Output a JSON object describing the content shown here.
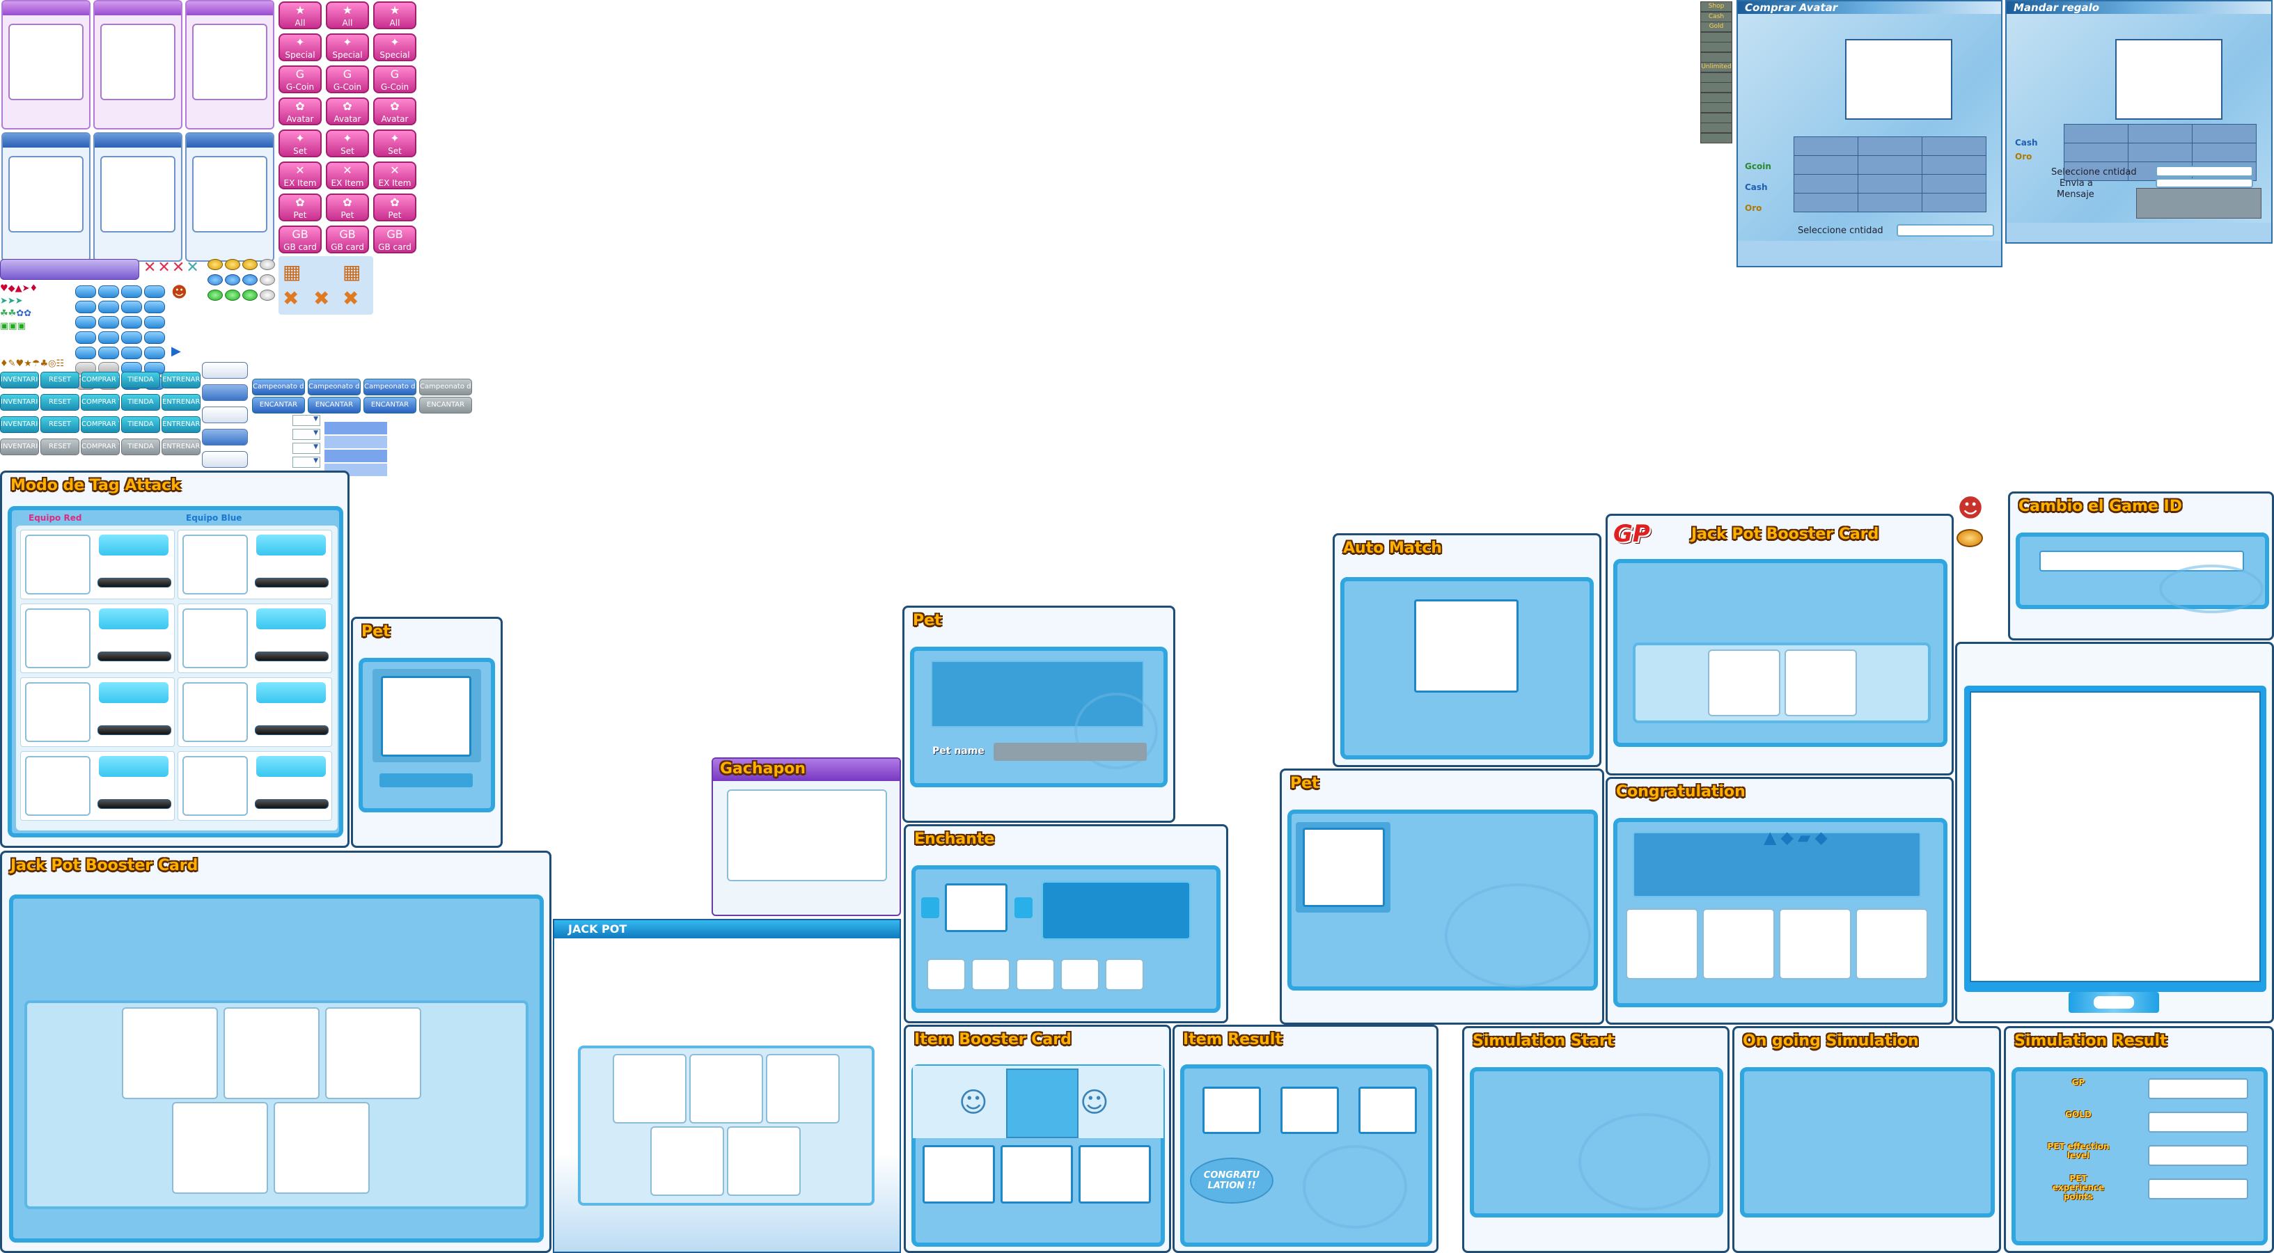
{
  "pink_buttons": [
    {
      "label": "All",
      "icon": "★"
    },
    {
      "label": "Special",
      "icon": "✦"
    },
    {
      "label": "G-Coin",
      "icon": "G"
    },
    {
      "label": "Avatar",
      "icon": "✿"
    },
    {
      "label": "Set",
      "icon": "✦"
    },
    {
      "label": "EX Item",
      "icon": "✕"
    },
    {
      "label": "Pet",
      "icon": "✿"
    },
    {
      "label": "GB card",
      "icon": "GB"
    }
  ],
  "tab_buttons": {
    "row": [
      "INVENTARIO",
      "RESET",
      "COMPRAR TODO",
      "TIENDA",
      "ENTRENAR MASCOTA"
    ],
    "channel": [
      "Campeonato de seal",
      "ENCANTAR"
    ]
  },
  "side_tags": [
    "Shop",
    "Cash",
    "Gold",
    "",
    "",
    "",
    "Unlimited",
    "",
    "",
    "",
    "",
    "",
    "",
    ""
  ],
  "buy_avatar": {
    "title": "Comprar Avatar",
    "rows": [
      {
        "label": "Gcoin",
        "color": "#2a8a2a"
      },
      {
        "label": "Cash",
        "color": "#1f5fb3"
      },
      {
        "label": "Oro",
        "color": "#b07800"
      }
    ],
    "select_qty": "Seleccione cntidad"
  },
  "send_gift": {
    "title": "Mandar regalo",
    "rows": [
      {
        "label": "Cash",
        "color": "#1f5fb3"
      },
      {
        "label": "Oro",
        "color": "#b07800"
      }
    ],
    "select_qty": "Seleccione cntidad",
    "send_to": "Envia a",
    "message": "Mensaje"
  },
  "tag_attack": {
    "title": "Modo de Tag Attack",
    "team_red": "Equipo Red",
    "team_blue": "Equipo Blue"
  },
  "pet_small": {
    "title": "Pet"
  },
  "gachapon": {
    "title": "Gachapon"
  },
  "jackpot_big": {
    "title": "Jack Pot Booster Card"
  },
  "jackpot_banner": {
    "title": "JACK POT"
  },
  "pet_name_panel": {
    "title": "Pet",
    "pet_name_label": "Pet name"
  },
  "enchant": {
    "title": "Enchante"
  },
  "item_booster": {
    "title": "Item Booster Card"
  },
  "item_result": {
    "title": "Item Result",
    "congrats": "CONGRATU LATION !!"
  },
  "auto_match": {
    "title": "Auto Match"
  },
  "pet_wide": {
    "title": "Pet"
  },
  "jackpot_gp": {
    "title": "Jack Pot Booster Card",
    "gp_logo": "GP"
  },
  "congratulation": {
    "title": "Congratulation"
  },
  "game_id": {
    "title": "Cambio el Game ID"
  },
  "sim_start": {
    "title": "Simulation Start"
  },
  "sim_ongoing": {
    "title": "On going Simulation"
  },
  "sim_result": {
    "title": "Simulation Result",
    "rows": [
      "GP",
      "GOLD",
      "PET effection level",
      "PET experience points"
    ]
  }
}
